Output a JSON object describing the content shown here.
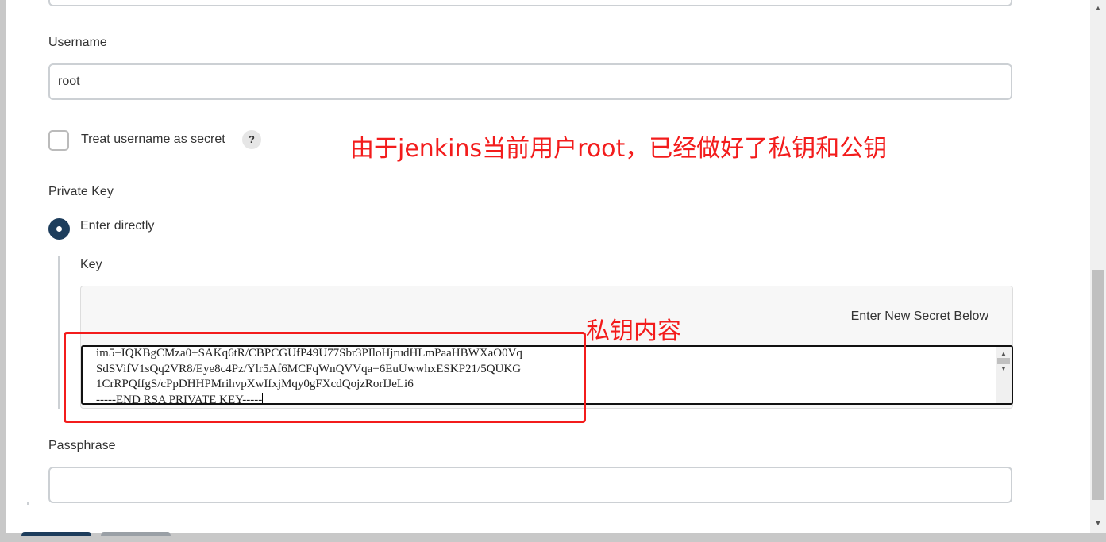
{
  "username": {
    "label": "Username",
    "value": "root"
  },
  "treat_secret": {
    "label": "Treat username as secret",
    "help": "?"
  },
  "private_key": {
    "label": "Private Key",
    "option": "Enter directly",
    "key_label": "Key",
    "secret_hint": "Enter New Secret Below",
    "lines": [
      "im5+IQKBgCMza0+SAKq6tR/CBPCGUfP49U77Sbr3PIloHjrudHLmPaaHBWXaO0Vq",
      "SdSVifV1sQq2VR8/Eye8c4Pz/Ylr5Af6MCFqWnQVVqa+6EuUwwhxESKP21/5QUKG",
      "1CrRPQffgS/cPpDHHPMrihvpXwIfxjMqy0gFXcdQojzRorIJeLi6",
      "-----END RSA PRIVATE KEY-----"
    ]
  },
  "passphrase": {
    "label": "Passphrase",
    "value": ""
  },
  "annotations": {
    "note1": "由于jenkins当前用户root，已经做好了私钥和公钥",
    "note2": "私钥内容"
  },
  "colors": {
    "radio": "#1d3d5c",
    "annotation": "#f31c1c"
  }
}
